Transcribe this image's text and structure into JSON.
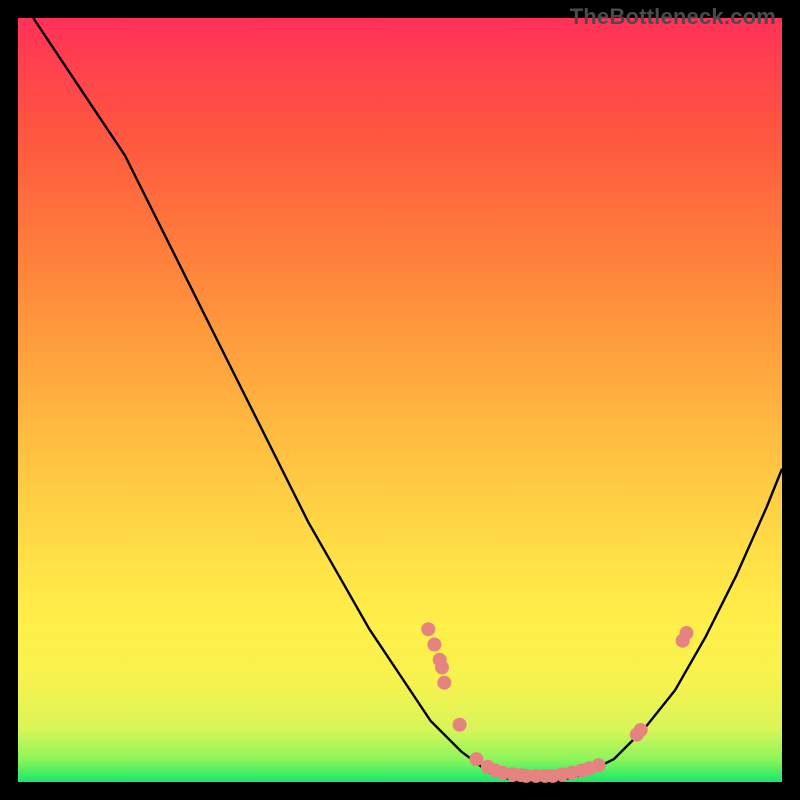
{
  "watermark": "TheBottleneck.com",
  "colors": {
    "curve": "#000000",
    "dot": "#e6827f",
    "frame_bg": "#000000"
  },
  "chart_data": {
    "type": "line",
    "title": "",
    "xlabel": "",
    "ylabel": "",
    "xlim": [
      0,
      1
    ],
    "ylim": [
      0,
      1
    ],
    "curve": [
      {
        "x": 0.02,
        "y": 1.0
      },
      {
        "x": 0.06,
        "y": 0.94
      },
      {
        "x": 0.1,
        "y": 0.88
      },
      {
        "x": 0.14,
        "y": 0.82
      },
      {
        "x": 0.18,
        "y": 0.74
      },
      {
        "x": 0.22,
        "y": 0.66
      },
      {
        "x": 0.26,
        "y": 0.58
      },
      {
        "x": 0.3,
        "y": 0.5
      },
      {
        "x": 0.34,
        "y": 0.42
      },
      {
        "x": 0.38,
        "y": 0.34
      },
      {
        "x": 0.42,
        "y": 0.27
      },
      {
        "x": 0.46,
        "y": 0.2
      },
      {
        "x": 0.5,
        "y": 0.14
      },
      {
        "x": 0.54,
        "y": 0.08
      },
      {
        "x": 0.58,
        "y": 0.04
      },
      {
        "x": 0.62,
        "y": 0.01
      },
      {
        "x": 0.66,
        "y": 0.0
      },
      {
        "x": 0.7,
        "y": 0.0
      },
      {
        "x": 0.74,
        "y": 0.01
      },
      {
        "x": 0.78,
        "y": 0.03
      },
      {
        "x": 0.82,
        "y": 0.07
      },
      {
        "x": 0.86,
        "y": 0.12
      },
      {
        "x": 0.9,
        "y": 0.19
      },
      {
        "x": 0.94,
        "y": 0.27
      },
      {
        "x": 0.98,
        "y": 0.36
      },
      {
        "x": 1.0,
        "y": 0.41
      }
    ],
    "dots": [
      {
        "x": 0.537,
        "y": 0.2
      },
      {
        "x": 0.545,
        "y": 0.18
      },
      {
        "x": 0.552,
        "y": 0.16
      },
      {
        "x": 0.555,
        "y": 0.15
      },
      {
        "x": 0.558,
        "y": 0.13
      },
      {
        "x": 0.578,
        "y": 0.075
      },
      {
        "x": 0.6,
        "y": 0.03
      },
      {
        "x": 0.615,
        "y": 0.02
      },
      {
        "x": 0.625,
        "y": 0.015
      },
      {
        "x": 0.635,
        "y": 0.012
      },
      {
        "x": 0.648,
        "y": 0.01
      },
      {
        "x": 0.658,
        "y": 0.009
      },
      {
        "x": 0.665,
        "y": 0.008
      },
      {
        "x": 0.678,
        "y": 0.008
      },
      {
        "x": 0.69,
        "y": 0.008
      },
      {
        "x": 0.7,
        "y": 0.008
      },
      {
        "x": 0.712,
        "y": 0.01
      },
      {
        "x": 0.725,
        "y": 0.012
      },
      {
        "x": 0.738,
        "y": 0.015
      },
      {
        "x": 0.748,
        "y": 0.018
      },
      {
        "x": 0.76,
        "y": 0.022
      },
      {
        "x": 0.81,
        "y": 0.062
      },
      {
        "x": 0.815,
        "y": 0.068
      },
      {
        "x": 0.87,
        "y": 0.185
      },
      {
        "x": 0.875,
        "y": 0.195
      }
    ]
  }
}
